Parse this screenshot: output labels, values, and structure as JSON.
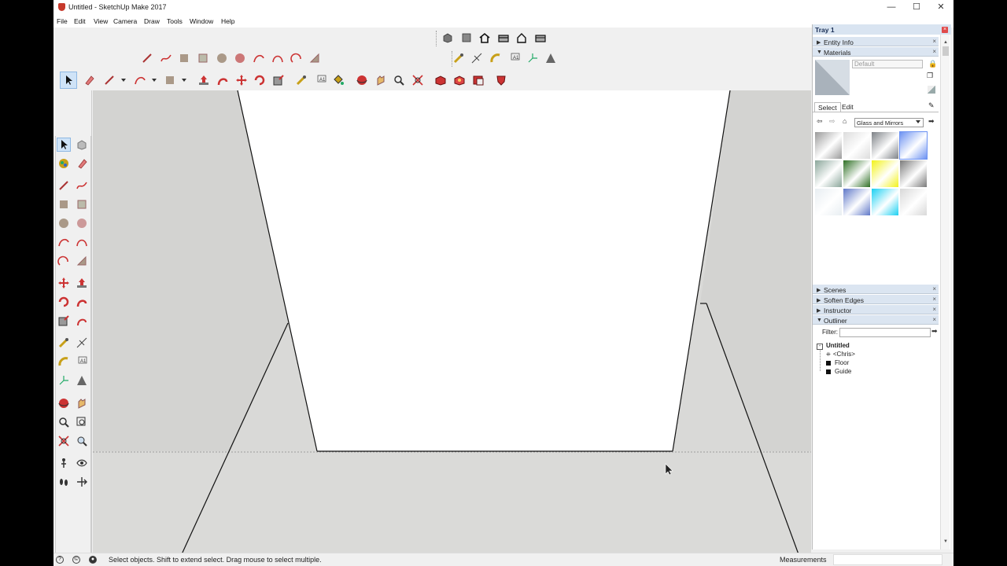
{
  "window": {
    "title": "Untitled - SketchUp Make 2017"
  },
  "menu": [
    "File",
    "Edit",
    "View",
    "Camera",
    "Draw",
    "Tools",
    "Window",
    "Help"
  ],
  "window_controls": {
    "minimize": "—",
    "maximize": "☐",
    "close": "✕"
  },
  "tray": {
    "title": "Tray 1",
    "panels_top": [
      {
        "label": "Entity Info",
        "expanded": false
      },
      {
        "label": "Materials",
        "expanded": true
      }
    ],
    "materials": {
      "current_name": "Default",
      "tabs": [
        "Select",
        "Edit"
      ],
      "active_tab": "Select",
      "library": "Glass and Mirrors",
      "swatch_colors": [
        "#9a9a9a",
        "#dcdcdc",
        "#7d8186",
        "#6d92f2",
        "#8aa69a",
        "#2e6f24",
        "#f2f21a",
        "#7a7a7a",
        "#e8eef2",
        "#5f78c8",
        "#1ad0f2",
        "#d8d8d8"
      ]
    },
    "panels_bottom": [
      {
        "label": "Scenes",
        "expanded": false
      },
      {
        "label": "Soften Edges",
        "expanded": false
      },
      {
        "label": "Instructor",
        "expanded": false
      },
      {
        "label": "Outliner",
        "expanded": true
      }
    ],
    "outliner": {
      "filter_label": "Filter:",
      "filter_value": "",
      "root": "Untitled",
      "items": [
        "<Chris>",
        "Floor",
        "Guide"
      ]
    }
  },
  "status": {
    "hint": "Select objects. Shift to extend select. Drag mouse to select multiple.",
    "measurements_label": "Measurements",
    "measurements_value": ""
  },
  "colors": {
    "viewport_bg": "#d9d9d7",
    "wall_white": "#ffffff",
    "tray_header": "#d9e4f1",
    "accent_red": "#c73a2c"
  }
}
